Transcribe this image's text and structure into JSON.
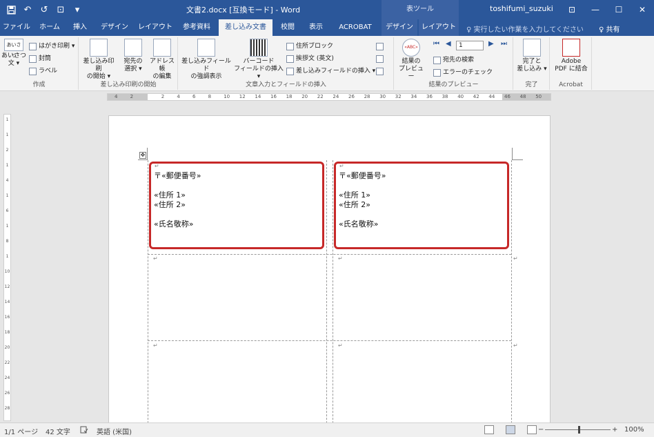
{
  "window": {
    "title": "文書2.docx [互換モード] - Word",
    "context_title": "表ツール",
    "user": "toshifumi_suzuki",
    "qat": {
      "save_icon": "save-icon",
      "undo": "↶",
      "redo": "↺",
      "print_preview": "⊡",
      "customize": "▾"
    },
    "controls": {
      "ribbon_options": "⊡",
      "minimize": "—",
      "maximize": "☐",
      "close": "✕"
    }
  },
  "tabs": [
    {
      "label": "ファイル"
    },
    {
      "label": "ホーム"
    },
    {
      "label": "挿入"
    },
    {
      "label": "デザイン"
    },
    {
      "label": "レイアウト"
    },
    {
      "label": "参考資料"
    },
    {
      "label": "差し込み文書"
    },
    {
      "label": "校閲"
    },
    {
      "label": "表示"
    },
    {
      "label": "ACROBAT"
    },
    {
      "label": "デザイン"
    },
    {
      "label": "レイアウト"
    }
  ],
  "tell_me": "♀ 実行したい作業を入力してください",
  "share": "♀ 共有",
  "ribbon": {
    "create": {
      "label": "作成",
      "greeting": [
        "あいさつ",
        "文 ▾"
      ],
      "greeting_icon_text": "あいさつ",
      "postcard": "はがき印刷 ▾",
      "envelope": "封筒",
      "labels": "ラベル"
    },
    "start": {
      "label": "差し込み印刷の開始",
      "start_merge": [
        "差し込み印刷",
        "の開始 ▾"
      ],
      "select_recipients": [
        "宛先の",
        "選択 ▾"
      ],
      "edit_list": [
        "アドレス帳",
        "の編集"
      ]
    },
    "fields": {
      "label": "文章入力とフィールドの挿入",
      "highlight": [
        "差し込みフィールド",
        "の強調表示"
      ],
      "barcode": [
        "バーコード",
        "フィールドの挿入 ▾"
      ],
      "address_block": "住所ブロック",
      "greeting_line": "挨拶文 (英文)",
      "insert_field": "差し込みフィールドの挿入 ▾"
    },
    "preview": {
      "label": "結果のプレビュー",
      "preview_results": [
        "結果の",
        "プレビュー"
      ],
      "preview_icon_text": "«ABC»",
      "record": "1",
      "first": "⏮",
      "prev": "◀",
      "next": "▶",
      "last": "⏭",
      "find_recipient": "宛先の検索",
      "check_errors": "エラーのチェック"
    },
    "finish": {
      "label": "完了",
      "finish_merge": [
        "完了と",
        "差し込み ▾"
      ]
    },
    "acrobat": {
      "label": "Acrobat",
      "pdf_merge": [
        "Adobe",
        "PDF に結合"
      ]
    }
  },
  "ruler": {
    "h_ticks": [
      "4",
      "2",
      "",
      "2",
      "4",
      "6",
      "8",
      "10",
      "12",
      "14",
      "16",
      "18",
      "20",
      "22",
      "24",
      "26",
      "28",
      "30",
      "32",
      "34",
      "36",
      "38",
      "40",
      "42",
      "44",
      "46",
      "48",
      "50"
    ],
    "v_ticks": [
      "1",
      "1",
      "2",
      "1",
      "4",
      "1",
      "6",
      "1",
      "8",
      "1",
      "10",
      "12",
      "14",
      "16",
      "18",
      "20",
      "22",
      "24",
      "26",
      "28"
    ]
  },
  "document": {
    "labels": [
      {
        "lines": [
          "〒«郵便番号»",
          "",
          "«住所 1»",
          "«住所 2»",
          "",
          "«氏名敬称»"
        ]
      },
      {
        "lines": [
          "〒«郵便番号»",
          "",
          "«住所 1»",
          "«住所 2»",
          "",
          "«氏名敬称»"
        ]
      }
    ],
    "para_mark": "↵",
    "move_handle": "✥"
  },
  "status": {
    "page": "1/1 ページ",
    "words": "42 文字",
    "language": "英語 (米国)",
    "zoom": "100%",
    "zoom_level": 0.5,
    "zoom_out": "−",
    "zoom_in": "+"
  }
}
